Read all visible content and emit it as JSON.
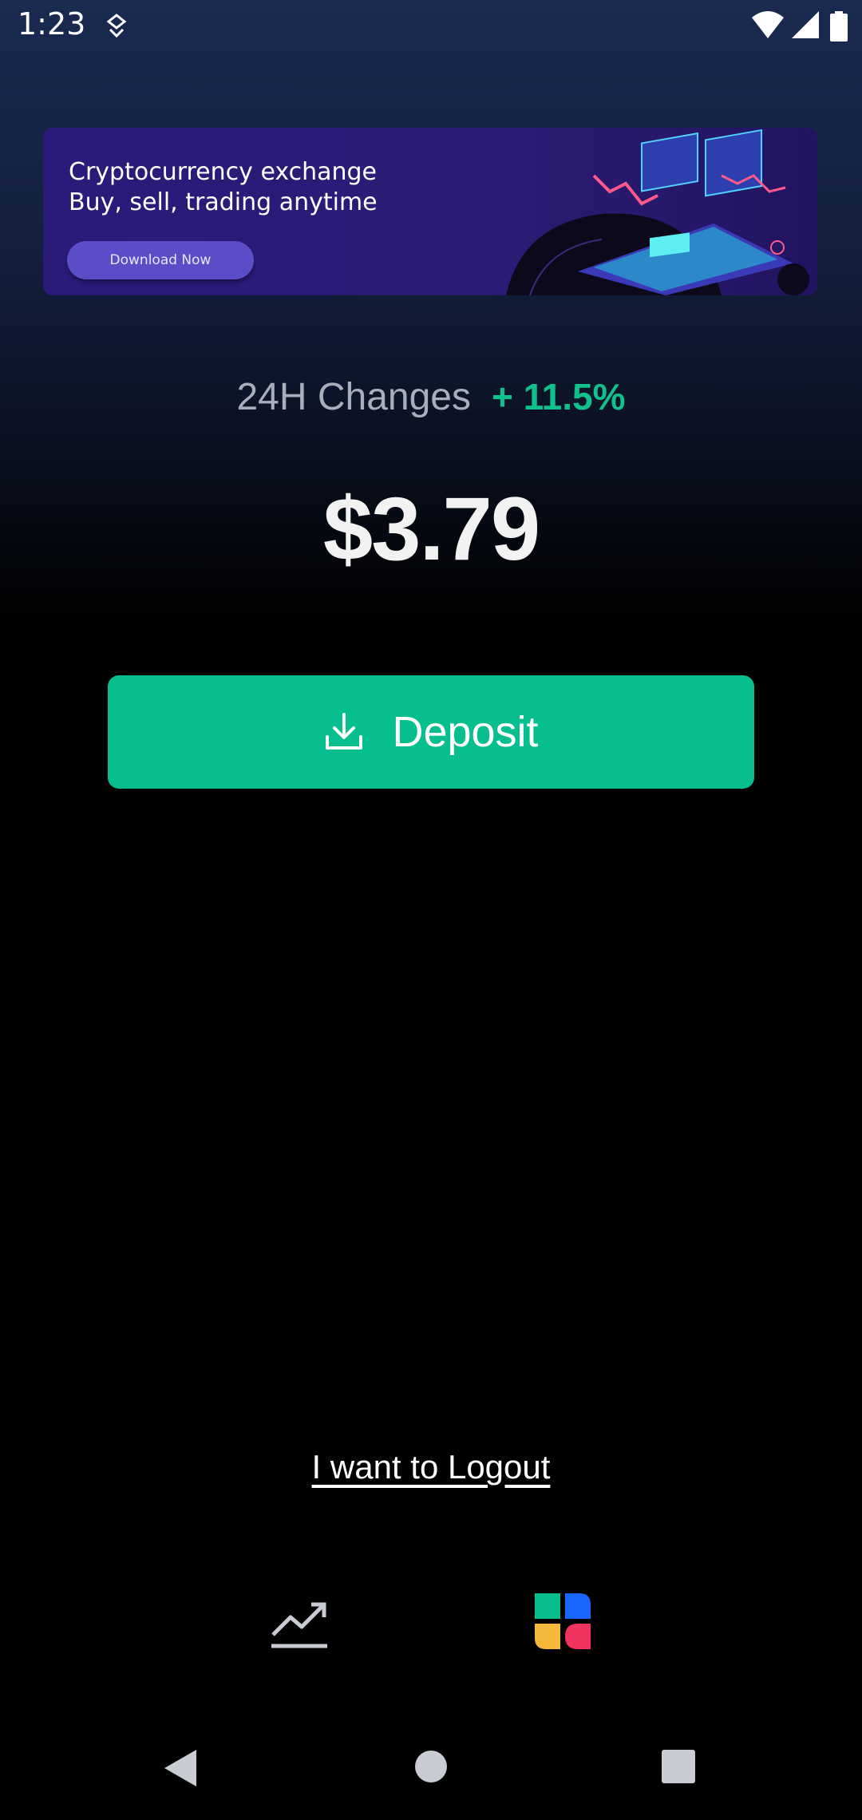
{
  "status_bar": {
    "time": "1:23",
    "icons": [
      "notification-icon",
      "wifi-icon",
      "signal-icon",
      "battery-icon"
    ]
  },
  "banner": {
    "line1": "Cryptocurrency exchange",
    "line2": "Buy, sell, trading anytime",
    "button_label": "Download Now",
    "colors": {
      "background": "#2a1a7a",
      "button": "#5b4dc8"
    }
  },
  "stats": {
    "change_label": "24H Changes",
    "change_value": "+ 11.5%",
    "balance": "$3.79"
  },
  "deposit": {
    "label": "Deposit",
    "icon": "download-icon"
  },
  "logout": {
    "label": "I want to Logout"
  },
  "bottom_nav": {
    "items": [
      {
        "name": "chart",
        "icon": "trending-up-icon"
      },
      {
        "name": "apps",
        "icon": "apps-grid-icon"
      }
    ]
  },
  "colors": {
    "accent": "#07bf8e",
    "positive": "#10c18e",
    "muted_text": "#a9aebb"
  }
}
